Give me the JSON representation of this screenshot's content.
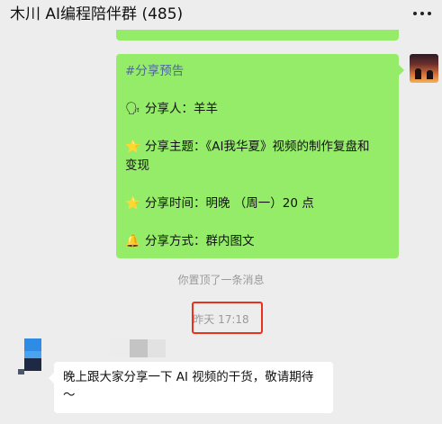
{
  "chat": {
    "title": "木川 AI编程陪伴群 (485)",
    "more_icon": "more-dots-icon"
  },
  "pinned_message": {
    "hashtag": "#分享预告",
    "speaker_icon": "🗣",
    "speaker_label": "分享人：羊羊",
    "topic_icon": "⭐",
    "topic_line1": "分享主题：《AI我华夏》视频的制作复盘和",
    "topic_line2": "变现",
    "time_icon": "⭐",
    "time_label": "分享时间：明晚 （周一）20 点",
    "method_icon": "🔔",
    "method_label": "分享方式：群内图文"
  },
  "system": {
    "pin_notice": "你置顶了一条消息",
    "timestamp": "昨天 17:18"
  },
  "incoming_message": {
    "text_line1": "晚上跟大家分享一下 AI 视频的干货，敬请期待",
    "text_line2": "～"
  },
  "colors": {
    "green_bubble": "#95ec69",
    "highlight_border": "#e6321e",
    "hashtag": "#4d6a91"
  }
}
